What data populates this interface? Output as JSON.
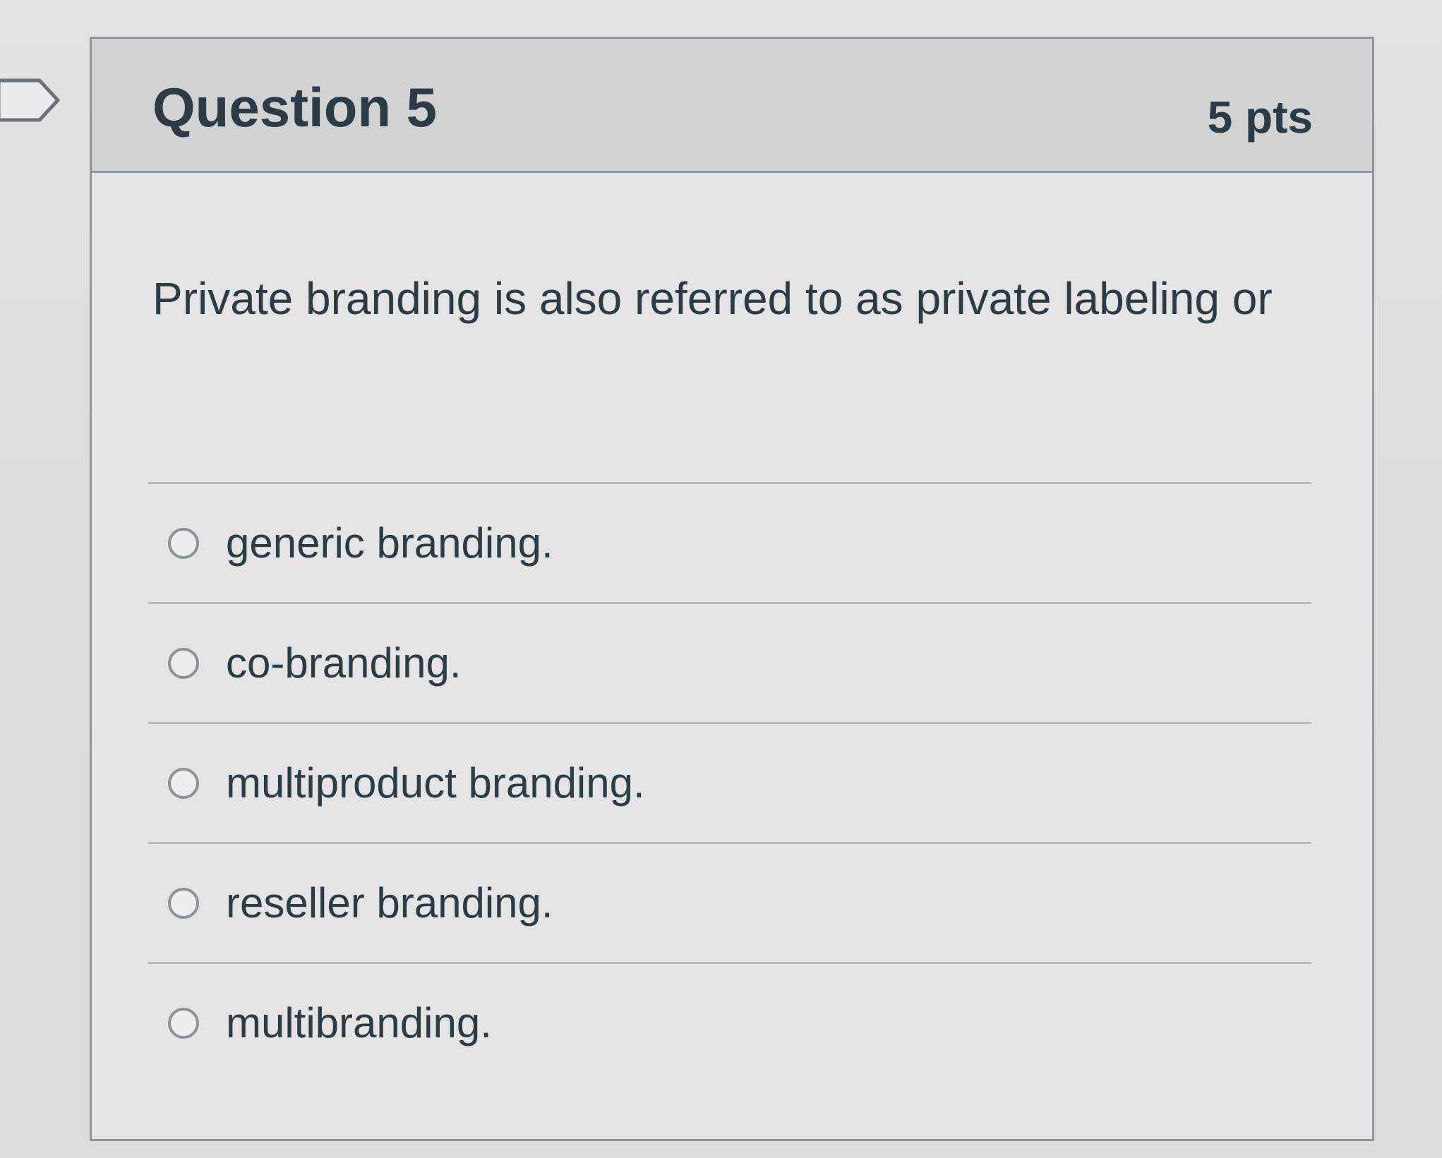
{
  "question": {
    "title": "Question 5",
    "points": "5 pts",
    "text": "Private branding is also referred to as private labeling or",
    "flag_icon": "flag-icon"
  },
  "answers": [
    {
      "label": "generic branding.",
      "selected": false
    },
    {
      "label": "co-branding.",
      "selected": false
    },
    {
      "label": "multiproduct branding.",
      "selected": false
    },
    {
      "label": "reseller branding.",
      "selected": false
    },
    {
      "label": "multibranding.",
      "selected": false
    }
  ],
  "colors": {
    "text": "#2d3b45",
    "header_bg": "#d1d3d2",
    "card_bg": "#e3e4e3",
    "border": "#8f9599"
  }
}
